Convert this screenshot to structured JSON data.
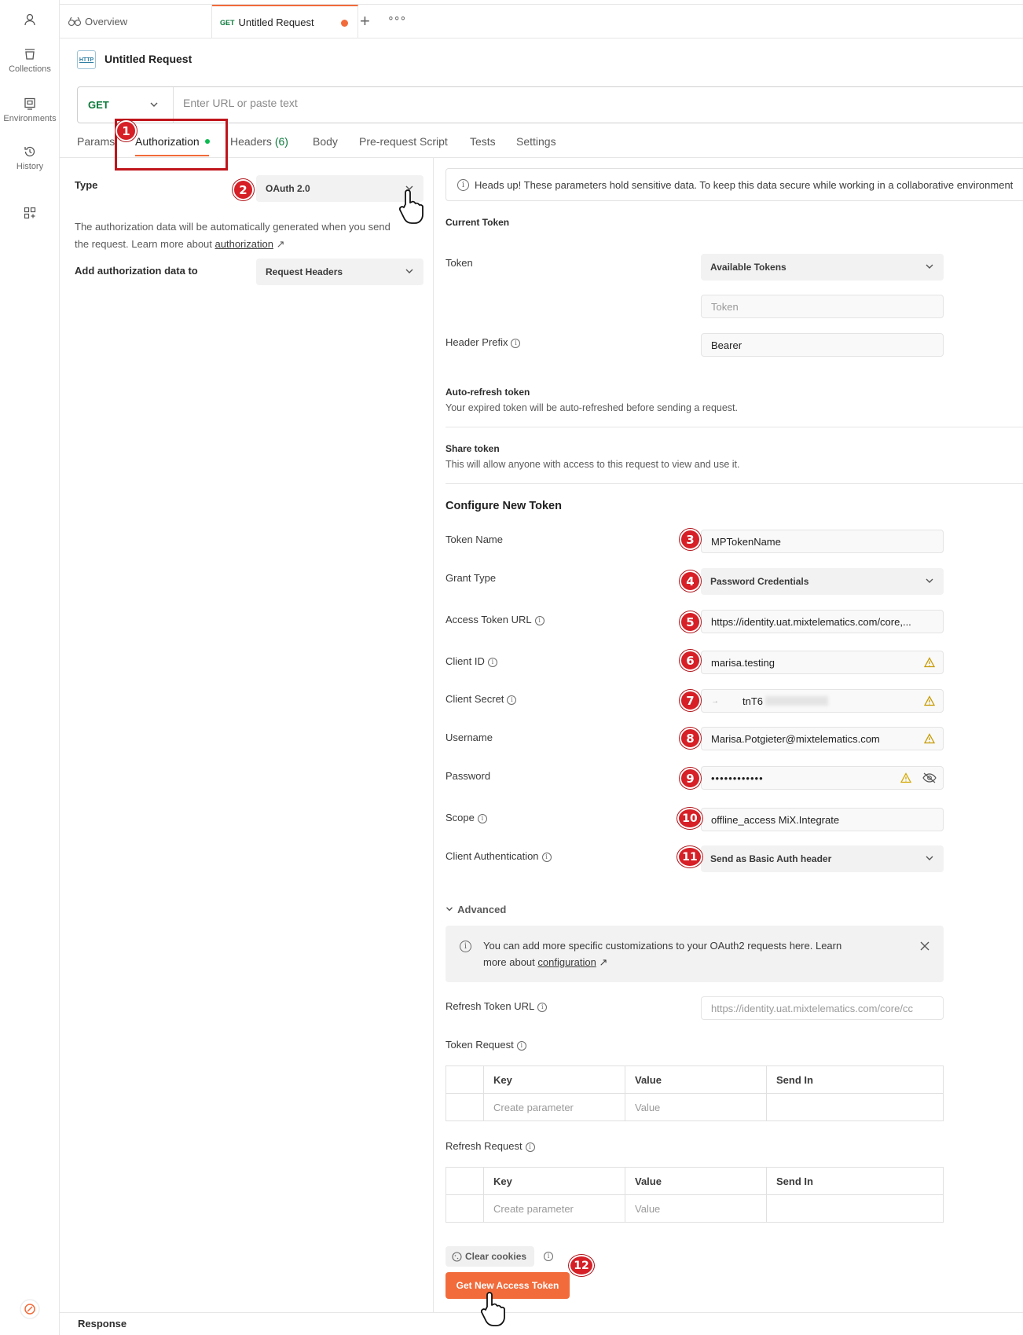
{
  "rail": {
    "items": [
      {
        "label": ""
      },
      {
        "label": "Collections"
      },
      {
        "label": "Environments"
      },
      {
        "label": "History"
      }
    ]
  },
  "tabs": {
    "overview": "Overview",
    "request_method": "GET",
    "request_name": "Untitled Request"
  },
  "request": {
    "title": "Untitled Request",
    "method": "GET",
    "url_placeholder": "Enter URL or paste text"
  },
  "subtabs": {
    "params": "Params",
    "authorization": "Authorization",
    "headers": "Headers",
    "headers_count": "(6)",
    "body": "Body",
    "prerequest": "Pre-request Script",
    "tests": "Tests",
    "settings": "Settings"
  },
  "auth": {
    "type_label": "Type",
    "type_value": "OAuth 2.0",
    "description_1": "The authorization data will be automatically generated when you send",
    "description_2": "the request. Learn more about",
    "description_link": "authorization",
    "add_to_label": "Add authorization data to",
    "add_to_value": "Request Headers"
  },
  "right": {
    "headsup": "Heads up! These parameters hold sensitive data. To keep this data secure while working in a collaborative environment",
    "current_token": "Current Token",
    "token_label": "Token",
    "available_tokens": "Available Tokens",
    "token_placeholder": "Token",
    "header_prefix_label": "Header Prefix",
    "header_prefix_value": "Bearer",
    "autorefresh_title": "Auto-refresh token",
    "autorefresh_desc": "Your expired token will be auto-refreshed before sending a request.",
    "share_title": "Share token",
    "share_desc": "This will allow anyone with access to this request to view and use it.",
    "configure_title": "Configure New Token",
    "token_name_label": "Token Name",
    "token_name_value": "MPTokenName",
    "grant_type_label": "Grant Type",
    "grant_type_value": "Password Credentials",
    "access_token_url_label": "Access Token URL",
    "access_token_url_value": "https://identity.uat.mixtelematics.com/core,...",
    "client_id_label": "Client ID",
    "client_id_value": "marisa.testing",
    "client_secret_label": "Client Secret",
    "client_secret_value": "tnT6",
    "username_label": "Username",
    "username_value": "Marisa.Potgieter@mixtelematics.com",
    "password_label": "Password",
    "password_value": "••••••••••••",
    "scope_label": "Scope",
    "scope_value": "offline_access MiX.Integrate",
    "client_auth_label": "Client Authentication",
    "client_auth_value": "Send as Basic Auth header",
    "advanced": "Advanced",
    "advanced_info_1": "You can add more specific customizations to your OAuth2 requests here. Learn",
    "advanced_info_2": "more about",
    "advanced_info_link": "configuration",
    "refresh_url_label": "Refresh Token URL",
    "refresh_url_placeholder": "https://identity.uat.mixtelematics.com/core/cc",
    "token_request_label": "Token Request",
    "refresh_request_label": "Refresh Request",
    "col_key": "Key",
    "col_value": "Value",
    "col_send_in": "Send In",
    "key_placeholder": "Create parameter",
    "value_placeholder": "Value",
    "clear_cookies": "Clear cookies",
    "get_token": "Get New Access Token"
  },
  "footer": {
    "response": "Response"
  },
  "badges": [
    "1",
    "2",
    "3",
    "4",
    "5",
    "6",
    "7",
    "8",
    "9",
    "10",
    "11",
    "12"
  ],
  "colors": {
    "accent": "#f26b3a",
    "method_green": "#0b7a3b",
    "annotation_red": "#d61f26",
    "highlight_box": "#c0141b"
  }
}
